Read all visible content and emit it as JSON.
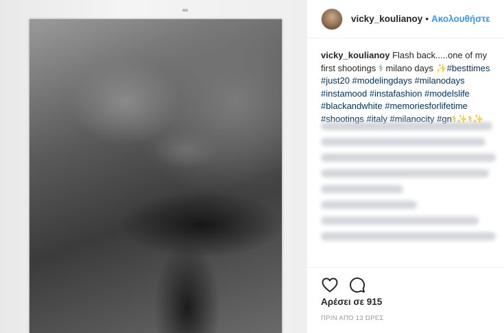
{
  "header": {
    "username": "vicky_koulianoy",
    "separator": "•",
    "follow_label": "Ακολουθήστε"
  },
  "caption": {
    "username": "vicky_koulianoy",
    "text_1": "Flash back.....one of my first shootings ",
    "emoji_1": "⚕",
    "text_2": "milano days ",
    "emoji_2": "✨",
    "tags": [
      "#besttimes",
      "#just20",
      "#modelingdays",
      "#milanodays",
      "#instamood",
      "#instafashion",
      "#modelslife",
      "#blackandwhite",
      "#memoriesforlifetime",
      "#shootings",
      "#italy",
      "#milanocity",
      "#gn"
    ],
    "trailing_emojis": "⚕✨⚕✨"
  },
  "actions": {
    "likes_text": "Αρέσει σε 915",
    "time_text": "ΠΡΙΝ ΑΠΌ 13 ΏΡΕΣ",
    "like_icon": "heart-outline-icon",
    "comment_icon": "comment-bubble-icon"
  },
  "colors": {
    "follow": "#3897f0",
    "hashtag": "#003569",
    "text": "#262626",
    "muted": "#999999"
  }
}
